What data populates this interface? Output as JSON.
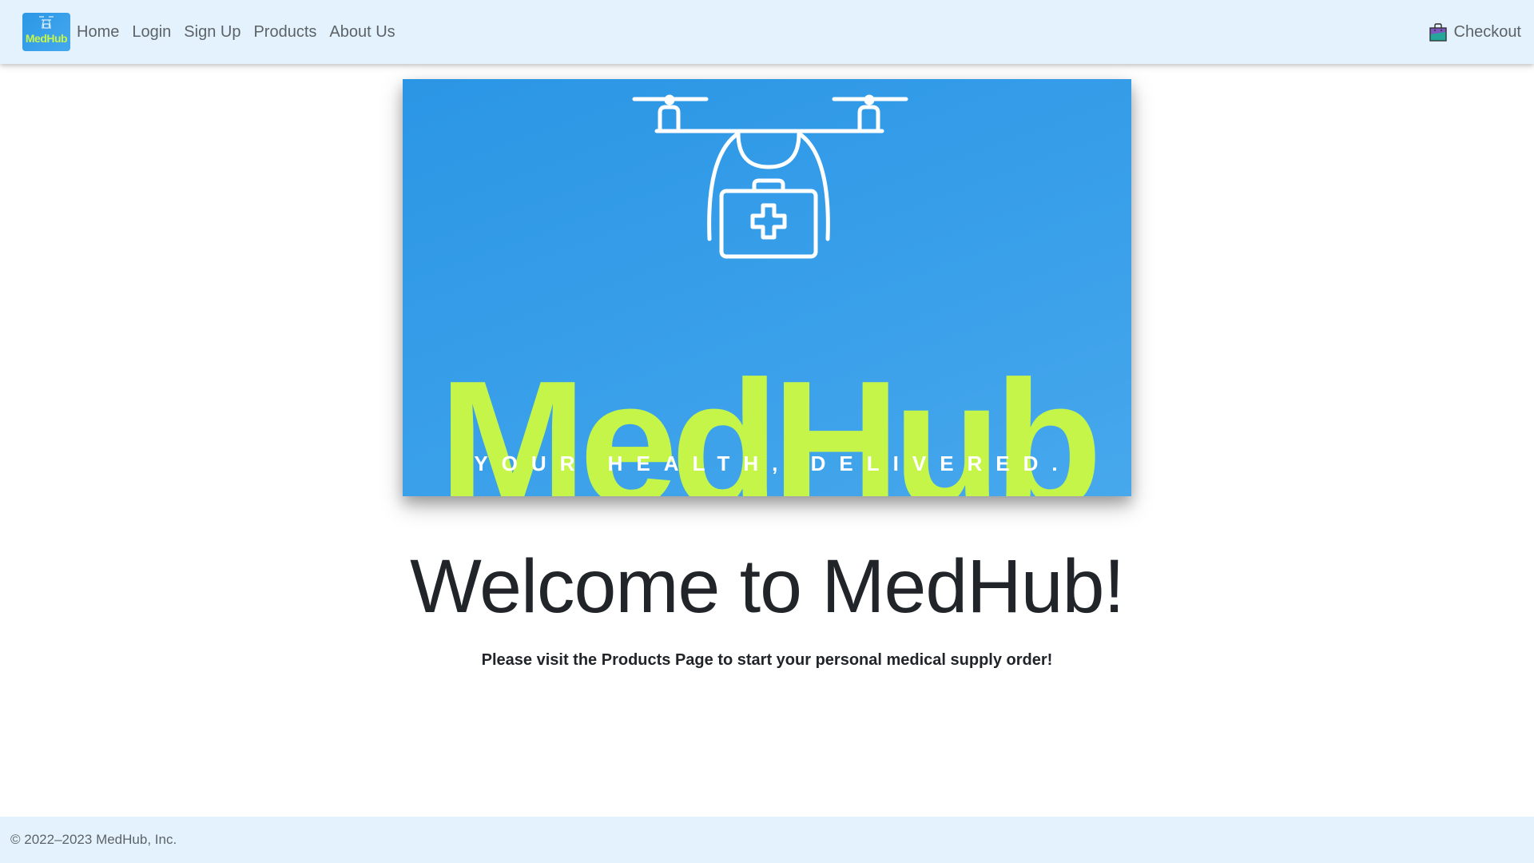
{
  "navbar": {
    "brand_text": "MedHub",
    "links": [
      "Home",
      "Login",
      "Sign Up",
      "Products",
      "About Us"
    ],
    "checkout_label": "Checkout",
    "checkout_icon": "shopping-bag-icon",
    "background": "#e3f2fd"
  },
  "hero": {
    "logo_text": "MedHub",
    "tagline": "YOUR HEALTH, DELIVERED.",
    "icon": "drone-medical-kit-icon",
    "background": "#2b96e5",
    "accent": "#c6f54a"
  },
  "main": {
    "heading": "Welcome to MedHub!",
    "subtitle": "Please visit the Products Page to start your personal medical supply order!"
  },
  "footer": {
    "copyright": "© 2022–2023 MedHub, Inc."
  }
}
